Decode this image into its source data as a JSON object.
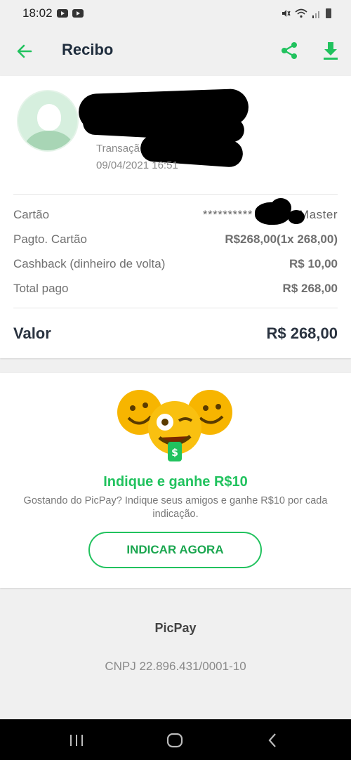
{
  "status_bar": {
    "time": "18:02"
  },
  "app_bar": {
    "title": "Recibo",
    "back_icon": "arrow-left-icon",
    "share_icon": "share-icon",
    "download_icon": "download-icon",
    "accent_color": "#21c25e"
  },
  "receipt": {
    "transaction_label": "Transaçã",
    "transaction_date": "09/04/2021 16:51",
    "rows": [
      {
        "label": "Cartão",
        "value": "**********",
        "value_suffix": "Master"
      },
      {
        "label": "Pagto. Cartão",
        "value": "R$268,00(1x 268,00)"
      },
      {
        "label": "Cashback (dinheiro de volta)",
        "value": "R$ 10,00"
      },
      {
        "label": "Total pago",
        "value": "R$ 268,00"
      }
    ],
    "total": {
      "label": "Valor",
      "value": "R$ 268,00"
    }
  },
  "promo": {
    "title": "Indique e ganhe R$10",
    "text": "Gostando do PicPay? Indique seus amigos e ganhe R$10 por cada indicação.",
    "button_label": "INDICAR AGORA",
    "image_icon": "money-emoji-icon",
    "badge_symbol": "$"
  },
  "footer": {
    "brand": "PicPay",
    "cnpj": "CNPJ 22.896.431/0001-10"
  },
  "nav": {
    "recents_icon": "recents-icon",
    "home_icon": "home-icon",
    "back_icon": "back-icon"
  }
}
